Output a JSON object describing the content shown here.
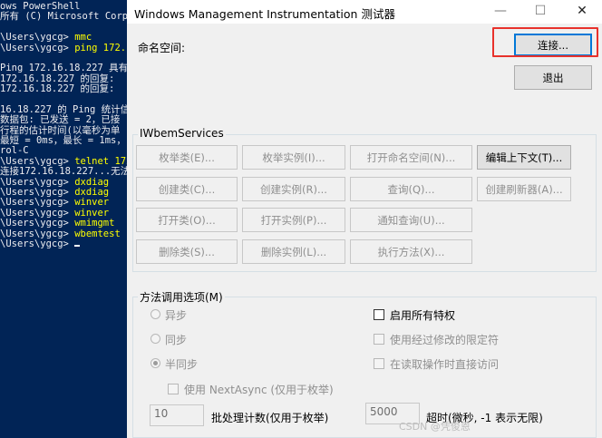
{
  "powershell": {
    "lines": [
      {
        "t": "ows PowerShell",
        "c": ""
      },
      {
        "t": "所有 (C) Microsoft Corpo",
        "c": ""
      },
      {
        "t": "",
        "c": ""
      },
      {
        "t": "\\Users\\ygcg> ",
        "c": "mmc"
      },
      {
        "t": "\\Users\\ygcg> ",
        "c": "ping 172.1"
      },
      {
        "t": "",
        "c": ""
      },
      {
        "t": "Ping 172.16.18.227 具有",
        "c": ""
      },
      {
        "t": "172.16.18.227 的回复: ",
        "c": ""
      },
      {
        "t": "172.16.18.227 的回复: ",
        "c": ""
      },
      {
        "t": "",
        "c": ""
      },
      {
        "t": "16.18.227 的 Ping 统计信",
        "c": ""
      },
      {
        "t": "数据包: 已发送 = 2，已接",
        "c": ""
      },
      {
        "t": "行程的估计时间(以毫秒为单",
        "c": ""
      },
      {
        "t": "最短 = 0ms，最长 = 1ms，",
        "c": ""
      },
      {
        "t": "rol-C",
        "c": ""
      },
      {
        "t": "\\Users\\ygcg> ",
        "c": "telnet 172"
      },
      {
        "t": "连接172.16.18.227...无法",
        "c": ""
      },
      {
        "t": "\\Users\\ygcg> ",
        "c": "dxdiag"
      },
      {
        "t": "\\Users\\ygcg> ",
        "c": "dxdiag"
      },
      {
        "t": "\\Users\\ygcg> ",
        "c": "winver"
      },
      {
        "t": "\\Users\\ygcg> ",
        "c": "winver"
      },
      {
        "t": "\\Users\\ygcg> ",
        "c": "wmimgmt"
      },
      {
        "t": "\\Users\\ygcg> ",
        "c": "wbemtest"
      },
      {
        "t": "\\Users\\ygcg> ",
        "c": ""
      }
    ]
  },
  "window": {
    "title": "Windows Management Instrumentation 测试器",
    "minimize": "—",
    "maximize": "☐",
    "close": "✕"
  },
  "namespace_label": "命名空间:",
  "connect_button": "连接...",
  "exit_button": "退出",
  "iwbem": {
    "title": "IWbemServices",
    "buttons": [
      {
        "label": "枚举类(E)...",
        "enabled": false
      },
      {
        "label": "枚举实例(I)...",
        "enabled": false
      },
      {
        "label": "打开命名空间(N)...",
        "enabled": false
      },
      {
        "label": "编辑上下文(T)...",
        "enabled": true
      },
      {
        "label": "创建类(C)...",
        "enabled": false
      },
      {
        "label": "创建实例(R)...",
        "enabled": false
      },
      {
        "label": "查询(Q)...",
        "enabled": false
      },
      {
        "label": "创建刷新器(A)...",
        "enabled": false
      },
      {
        "label": "打开类(O)...",
        "enabled": false
      },
      {
        "label": "打开实例(P)...",
        "enabled": false
      },
      {
        "label": "通知查询(U)...",
        "enabled": false
      },
      {
        "label": "删除类(S)...",
        "enabled": false
      },
      {
        "label": "删除实例(L)...",
        "enabled": false
      },
      {
        "label": "执行方法(X)...",
        "enabled": false
      }
    ]
  },
  "method_options": {
    "title": "方法调用选项(M)",
    "radios": [
      {
        "label": "异步",
        "checked": false
      },
      {
        "label": "同步",
        "checked": false
      },
      {
        "label": "半同步",
        "checked": true
      }
    ],
    "checks": [
      {
        "label": "启用所有特权",
        "checked": false,
        "enabled": true
      },
      {
        "label": "使用经过修改的限定符",
        "checked": false,
        "enabled": false
      },
      {
        "label": "在读取操作时直接访问",
        "checked": false,
        "enabled": false
      }
    ],
    "next_async_label": "使用 NextAsync (仅用于枚举)",
    "batch_value": "10",
    "batch_label": "批处理计数(仅用于枚举)",
    "timeout_value": "5000",
    "timeout_label": "超时(微秒, -1 表示无限)"
  },
  "watermark": "CSDN @凭俊恩"
}
